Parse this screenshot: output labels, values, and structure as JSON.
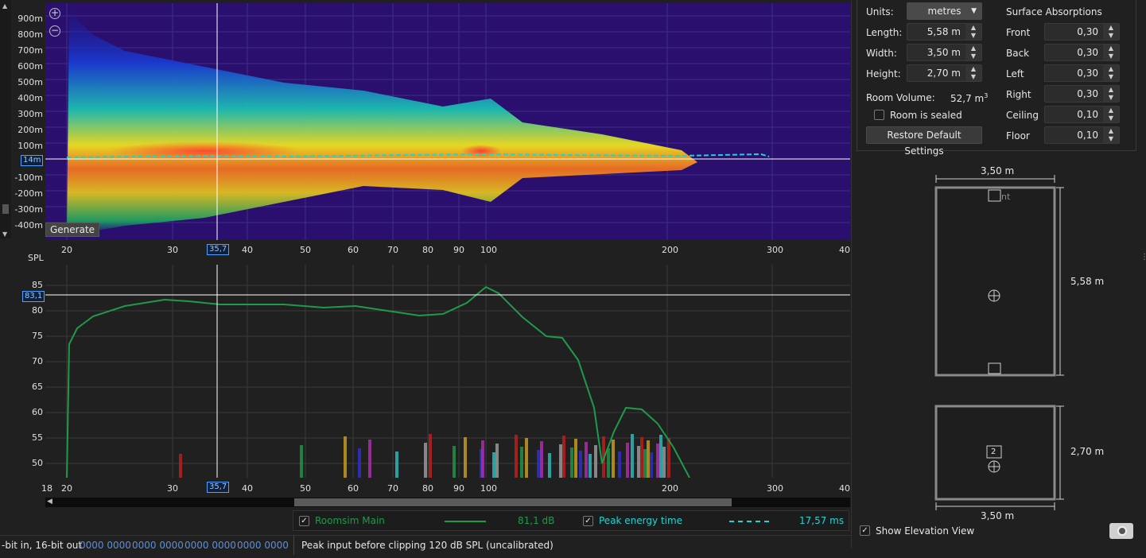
{
  "waterfall": {
    "y_labels": [
      "900m",
      "800m",
      "700m",
      "600m",
      "500m",
      "400m",
      "300m",
      "200m",
      "100m",
      "-100m",
      "-200m",
      "-300m",
      "-400m"
    ],
    "cursor_y_label": "14m",
    "generate_label": "Generate",
    "zoom_in_icon": "zoom-in-icon",
    "zoom_out_icon": "zoom-out-icon"
  },
  "x_axis": {
    "labels": [
      "20",
      "30",
      "40",
      "50",
      "60",
      "70",
      "80",
      "90",
      "100",
      "200",
      "300",
      "40"
    ],
    "cursor_x_label": "35,7"
  },
  "spl": {
    "title": "SPL",
    "y_labels": [
      "85",
      "80",
      "75",
      "70",
      "65",
      "60",
      "55",
      "50"
    ],
    "cursor_y_label": "83,1",
    "x_start_label": "18"
  },
  "legend": {
    "items": [
      {
        "checked": true,
        "name": "Roomsim Main",
        "value": "81,1 dB",
        "color": "#1e9a4a"
      },
      {
        "checked": true,
        "name": "Peak energy time",
        "value": "17,57 ms",
        "color": "#22d3d3"
      }
    ]
  },
  "status": {
    "format": "-bit in, 16-bit out",
    "meters": [
      "0000 0000",
      "0000 0000",
      "0000 0000",
      "0000 0000"
    ],
    "message": "Peak input before clipping 120 dB SPL (uncalibrated)"
  },
  "room": {
    "units_label": "Units:",
    "units_value": "metres",
    "length_label": "Length:",
    "length_value": "5,58 m",
    "width_label": "Width:",
    "width_value": "3,50 m",
    "height_label": "Height:",
    "height_value": "2,70 m",
    "volume_label": "Room Volume:",
    "volume_value": "52,7 m",
    "volume_sup": "3",
    "sealed_label": "Room is sealed",
    "sealed_checked": false,
    "restore_label": "Restore Default Settings",
    "absorptions_title": "Surface Absorptions",
    "surfaces": [
      {
        "label": "Front",
        "value": "0,30"
      },
      {
        "label": "Back",
        "value": "0,30"
      },
      {
        "label": "Left",
        "value": "0,30"
      },
      {
        "label": "Right",
        "value": "0,30"
      },
      {
        "label": "Ceiling",
        "value": "0,10"
      },
      {
        "label": "Floor",
        "value": "0,10"
      }
    ]
  },
  "plan": {
    "top_dim": "3,50 m",
    "side_dim": "5,58 m",
    "elev_side_dim": "2,70 m",
    "elev_bottom_dim": "3,50 m",
    "speaker_text": "nt",
    "elev_speaker_num": "2",
    "show_elevation_label": "Show Elevation View",
    "show_elevation_checked": true,
    "camera_icon": "camera-icon"
  }
}
